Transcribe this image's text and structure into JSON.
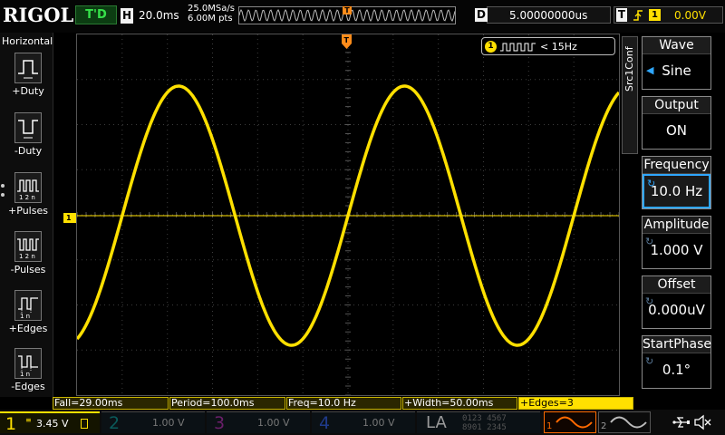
{
  "brand": "RIGOL",
  "trigger_status": "T'D",
  "horizontal": {
    "letter": "H",
    "timebase": "20.0ms",
    "sample_rate": "25.0MSa/s",
    "memory_depth": "6.00M pts"
  },
  "delay": {
    "letter": "D",
    "value": "5.00000000us"
  },
  "trigger": {
    "letter": "T",
    "source": "1",
    "level": "0.00V"
  },
  "left_menu": {
    "title": "Horizontal",
    "items": [
      {
        "label": "+Duty",
        "icon": "positive-duty-icon"
      },
      {
        "label": "-Duty",
        "icon": "negative-duty-icon"
      },
      {
        "label": "+Pulses",
        "icon": "positive-pulses-icon"
      },
      {
        "label": "-Pulses",
        "icon": "negative-pulses-icon"
      },
      {
        "label": "+Edges",
        "icon": "rising-edges-icon"
      },
      {
        "label": "-Edges",
        "icon": "falling-edges-icon"
      }
    ]
  },
  "freq_counter": {
    "channel": "1",
    "value": "< 15Hz"
  },
  "ch1_marker": "1",
  "trigger_marker": "T",
  "right_panel": {
    "tab_label": "Src1Conf",
    "wave": {
      "label": "Wave",
      "value": "Sine"
    },
    "output": {
      "label": "Output",
      "value": "ON"
    },
    "frequency": {
      "label": "Frequency",
      "value": "10.0 Hz"
    },
    "amplitude": {
      "label": "Amplitude",
      "value": "1.000 V"
    },
    "offset": {
      "label": "Offset",
      "value": "0.000uV"
    },
    "start_phase": {
      "label": "StartPhase",
      "value": "0.1°"
    }
  },
  "measurements": [
    {
      "text": "Fall=29.00ms"
    },
    {
      "text": "Period=100.0ms"
    },
    {
      "text": "Freq=10.0 Hz"
    },
    {
      "text": "+Width=50.00ms"
    },
    {
      "text": "+Edges=3"
    }
  ],
  "channels": [
    {
      "num": "1",
      "scale": "3.45 V",
      "color": "#ffe000",
      "active": true
    },
    {
      "num": "2",
      "scale": "1.00 V",
      "color": "#00c8c8",
      "active": false
    },
    {
      "num": "3",
      "scale": "1.00 V",
      "color": "#e040e0",
      "active": false
    },
    {
      "num": "4",
      "scale": "1.00 V",
      "color": "#3a6cff",
      "active": false
    }
  ],
  "la": {
    "label": "LA",
    "digits_top": "0123 4567",
    "digits_bot": "8901 2345"
  },
  "sources": [
    {
      "num": "1"
    },
    {
      "num": "2"
    }
  ],
  "waveform": {
    "channel": "1",
    "shape": "sine",
    "frequency_hz": 10,
    "time_per_div_ms": 20,
    "color": "#ffe000"
  },
  "colors": {
    "ch1": "#ffe000",
    "trigger": "#ff8c1a",
    "select": "#2fa7ff",
    "source1": "#ff6a00"
  }
}
